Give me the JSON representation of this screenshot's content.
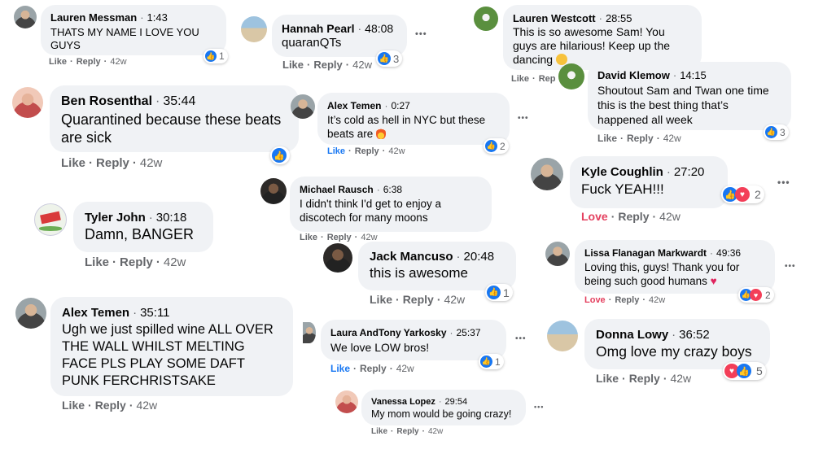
{
  "comments": [
    {
      "author": "Lauren Messman",
      "time": "1:43",
      "text": "THATS MY NAME I LOVE YOU GUYS",
      "like": "Like",
      "reply": "Reply",
      "age": "42w",
      "reactions": "1"
    },
    {
      "author": "Hannah Pearl",
      "time": "48:08",
      "text": "quaranQTs",
      "like": "Like",
      "reply": "Reply",
      "age": "42w",
      "reactions": "3"
    },
    {
      "author": "Lauren Westcott",
      "time": "28:55",
      "text": "This is so awesome Sam! You guys are hilarious! Keep up the dancing",
      "like": "Like",
      "reply": "Rep"
    },
    {
      "author": "David Klemow",
      "time": "14:15",
      "text": "Shoutout Sam and Twan one time this is the best thing that’s happened all week",
      "like": "Like",
      "reply": "Reply",
      "age": "42w",
      "reactions": "3"
    },
    {
      "author": "Ben Rosenthal",
      "time": "35:44",
      "text": "Quarantined because these beats are sick",
      "like": "Like",
      "reply": "Reply",
      "age": "42w"
    },
    {
      "author": "Alex Temen",
      "time": "0:27",
      "text": "It’s cold as hell in NYC but these beats are",
      "like": "Like",
      "reply": "Reply",
      "age": "42w",
      "reactions": "2"
    },
    {
      "author": "Kyle Coughlin",
      "time": "27:20",
      "text": "Fuck YEAH!!!",
      "like": "Love",
      "reply": "Reply",
      "age": "42w",
      "reactions": "2"
    },
    {
      "author": "Michael Rausch",
      "time": "6:38",
      "text": "I didn't think I'd get to enjoy a discotech for many moons",
      "like": "Like",
      "reply": "Reply",
      "age": "42w"
    },
    {
      "author": "Tyler John",
      "time": "30:18",
      "text": "Damn, BANGER",
      "like": "Like",
      "reply": "Reply",
      "age": "42w"
    },
    {
      "author": "Jack Mancuso",
      "time": "20:48",
      "text": "this is awesome",
      "like": "Like",
      "reply": "Reply",
      "age": "42w",
      "reactions": "1"
    },
    {
      "author": "Lissa Flanagan Markwardt",
      "time": "49:36",
      "text": "Loving this, guys! Thank you for being such good humans",
      "like": "Love",
      "reply": "Reply",
      "age": "42w",
      "reactions": "2"
    },
    {
      "author": "Alex Temen",
      "time": "35:11",
      "text": "Ugh we just spilled wine ALL OVER THE WALL WHILST MELTING FACE PLS PLAY SOME DAFT PUNK FERCHRISTSAKE",
      "like": "Like",
      "reply": "Reply",
      "age": "42w"
    },
    {
      "author": "Laura AndTony Yarkosky",
      "time": "25:37",
      "text": "We love LOW bros!",
      "like": "Like",
      "reply": "Reply",
      "age": "42w",
      "reactions": "1"
    },
    {
      "author": "Donna Lowy",
      "time": "36:52",
      "text": "Omg love my crazy boys",
      "like": "Like",
      "reply": "Reply",
      "age": "42w",
      "reactions": "5"
    },
    {
      "author": "Vanessa Lopez",
      "time": "29:54",
      "text": "My mom would be going crazy!",
      "like": "Like",
      "reply": "Reply",
      "age": "42w"
    }
  ],
  "more_glyph": "•••",
  "dot_glyph": "·"
}
